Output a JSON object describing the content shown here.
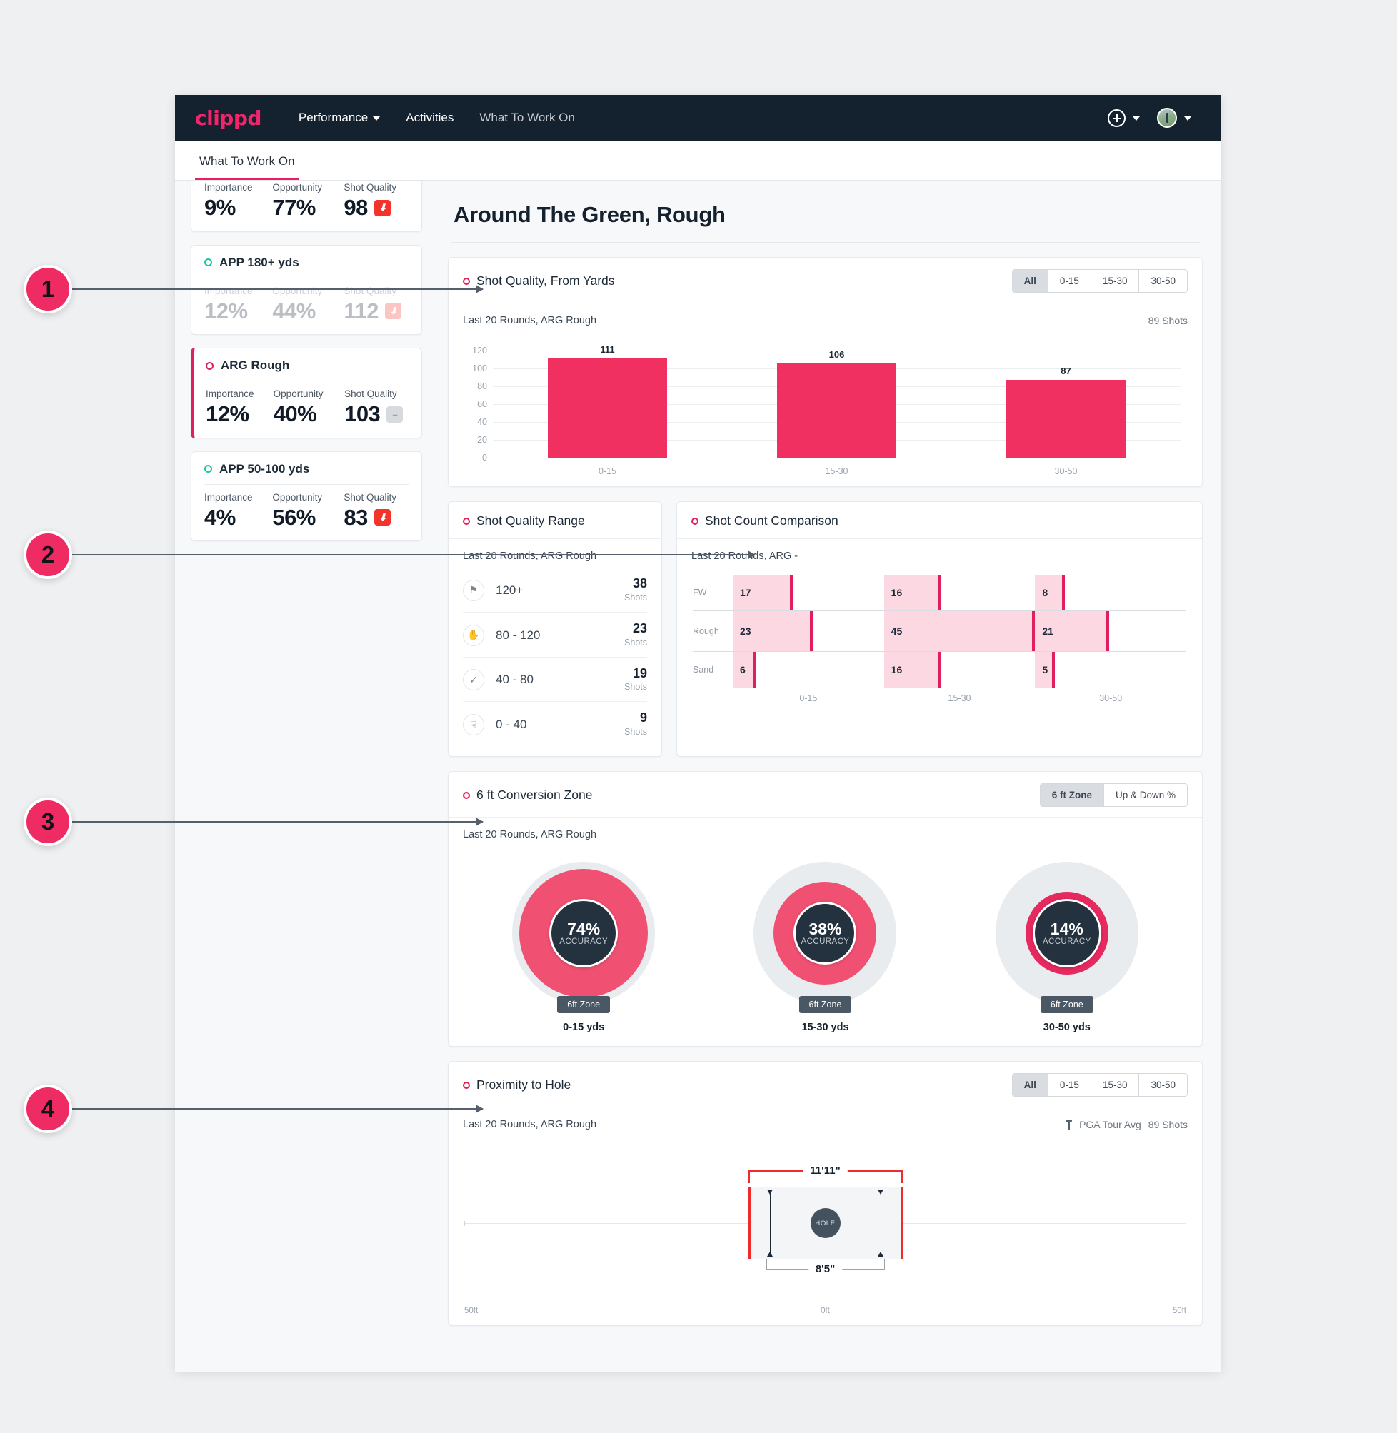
{
  "nav": {
    "brand": "clippd",
    "links": [
      {
        "label": "Performance",
        "has_caret": true
      },
      {
        "label": "Activities",
        "has_caret": false
      },
      {
        "label": "What To Work On",
        "has_caret": false
      }
    ],
    "add_icon": "plus-circle-icon",
    "avatar_icon": "user-avatar"
  },
  "subtab": {
    "label": "What To Work On"
  },
  "page": {
    "title": "Around The Green, Rough"
  },
  "sidebar": {
    "cards": [
      {
        "name": "",
        "metrics": [
          {
            "label": "Importance",
            "value": "9%"
          },
          {
            "label": "Opportunity",
            "value": "77%"
          },
          {
            "label": "Shot Quality",
            "value": "98",
            "trend": "down"
          }
        ]
      },
      {
        "name": "APP 180+ yds",
        "metrics": [
          {
            "label": "Importance",
            "value": "12%"
          },
          {
            "label": "Opportunity",
            "value": "44%"
          },
          {
            "label": "Shot Quality",
            "value": "112",
            "trend": "down"
          }
        ]
      },
      {
        "name": "ARG Rough",
        "selected": true,
        "metrics": [
          {
            "label": "Importance",
            "value": "12%"
          },
          {
            "label": "Opportunity",
            "value": "40%"
          },
          {
            "label": "Shot Quality",
            "value": "103",
            "trend": "flat"
          }
        ]
      },
      {
        "name": "APP 50-100 yds",
        "metrics": [
          {
            "label": "Importance",
            "value": "4%"
          },
          {
            "label": "Opportunity",
            "value": "56%"
          },
          {
            "label": "Shot Quality",
            "value": "83",
            "trend": "down"
          }
        ]
      }
    ]
  },
  "shot_quality_from_yards": {
    "title": "Shot Quality, From Yards",
    "segments": [
      "All",
      "0-15",
      "15-30",
      "30-50"
    ],
    "active_segment": "All",
    "subtitle": "Last 20 Rounds, ARG Rough",
    "shots": "89 Shots"
  },
  "shot_quality_range": {
    "title": "Shot Quality Range",
    "subtitle": "Last 20 Rounds, ARG Rough",
    "rows": [
      {
        "icon": "medal-icon",
        "glyph": "☑",
        "label": "120+",
        "count": "38",
        "unit": "Shots"
      },
      {
        "icon": "clap-icon",
        "glyph": "✋",
        "label": "80 - 120",
        "count": "23",
        "unit": "Shots"
      },
      {
        "icon": "check-icon",
        "glyph": "✓",
        "label": "40 - 80",
        "count": "19",
        "unit": "Shots"
      },
      {
        "icon": "thumbs-down-icon",
        "glyph": "☟",
        "label": "0 - 40",
        "count": "9",
        "unit": "Shots"
      }
    ]
  },
  "shot_count_comparison": {
    "title": "Shot Count Comparison",
    "subtitle": "Last 20 Rounds, ARG -"
  },
  "conversion_zone": {
    "title": "6 ft Conversion Zone",
    "segments": [
      "6 ft Zone",
      "Up & Down %"
    ],
    "active_segment": "6 ft Zone",
    "subtitle": "Last 20 Rounds, ARG Rough",
    "donuts": [
      {
        "value": "74%",
        "sub": "ACCURACY",
        "tag": "6ft Zone",
        "caption": "0-15 yds",
        "pct": 74
      },
      {
        "value": "38%",
        "sub": "ACCURACY",
        "tag": "6ft Zone",
        "caption": "15-30 yds",
        "pct": 38
      },
      {
        "value": "14%",
        "sub": "ACCURACY",
        "tag": "6ft Zone",
        "caption": "30-50 yds",
        "pct": 14
      }
    ]
  },
  "proximity": {
    "title": "Proximity to Hole",
    "segments": [
      "All",
      "0-15",
      "15-30",
      "30-50"
    ],
    "active_segment": "All",
    "subtitle": "Last 20 Rounds, ARG Rough",
    "tour_avg_label": "PGA Tour Avg",
    "shots": "89 Shots",
    "outer_dim": "11'11\"",
    "inner_dim": "8'5\"",
    "hole_label": "HOLE",
    "axis": {
      "left": "50ft",
      "center": "0ft",
      "right": "50ft"
    }
  },
  "callouts": [
    {
      "number": "1"
    },
    {
      "number": "2"
    },
    {
      "number": "3"
    },
    {
      "number": "4"
    }
  ],
  "colors": {
    "accent_pink": "#ef3061",
    "brand_pink": "#f4246b",
    "nav_dark": "#14212e",
    "bar_fill": "#ef3061",
    "soft_pink": "#fcd8e2",
    "teal": "#14c8a0"
  },
  "chart_data": [
    {
      "type": "bar",
      "title": "Shot Quality, From Yards",
      "subtitle": "Last 20 Rounds, ARG Rough",
      "categories": [
        "0-15",
        "15-30",
        "30-50"
      ],
      "values": [
        111,
        106,
        87
      ],
      "xlabel": "",
      "ylabel": "",
      "ylim": [
        0,
        120
      ],
      "yticks": [
        0,
        20,
        40,
        60,
        80,
        100,
        120
      ],
      "grid": true,
      "legend": "none",
      "annotations": [
        "89 Shots"
      ]
    },
    {
      "type": "bar",
      "title": "Shot Count Comparison",
      "subtitle": "Last 20 Rounds, ARG -",
      "orientation": "grouped-horizontal",
      "categories": [
        "0-15",
        "15-30",
        "30-50"
      ],
      "series": [
        {
          "name": "FW",
          "values": [
            17,
            16,
            8
          ]
        },
        {
          "name": "Rough",
          "values": [
            23,
            45,
            21
          ]
        },
        {
          "name": "Sand",
          "values": [
            6,
            16,
            5
          ]
        }
      ],
      "max_value": 45,
      "grid": false,
      "legend": "y-axis-labels"
    },
    {
      "type": "pie",
      "title": "6 ft Conversion Zone",
      "subtitle": "Last 20 Rounds, ARG Rough",
      "categories": [
        "0-15 yds",
        "15-30 yds",
        "30-50 yds"
      ],
      "values": [
        74,
        38,
        14
      ],
      "ylabel": "ACCURACY",
      "annotations": [
        "6ft Zone",
        "6ft Zone",
        "6ft Zone"
      ]
    },
    {
      "type": "table",
      "title": "Shot Quality Range",
      "subtitle": "Last 20 Rounds, ARG Rough",
      "categories": [
        "120+",
        "80 - 120",
        "40 - 80",
        "0 - 40"
      ],
      "values": [
        38,
        23,
        19,
        9
      ],
      "ylabel": "Shots"
    },
    {
      "type": "scatter",
      "title": "Proximity to Hole",
      "subtitle": "Last 20 Rounds, ARG Rough",
      "x": [
        -50,
        0,
        50
      ],
      "xticks": [
        "50ft",
        "0ft",
        "50ft"
      ],
      "annotations": [
        "11'11\"",
        "8'5\"",
        "HOLE",
        "PGA Tour Avg",
        "89 Shots"
      ]
    }
  ]
}
